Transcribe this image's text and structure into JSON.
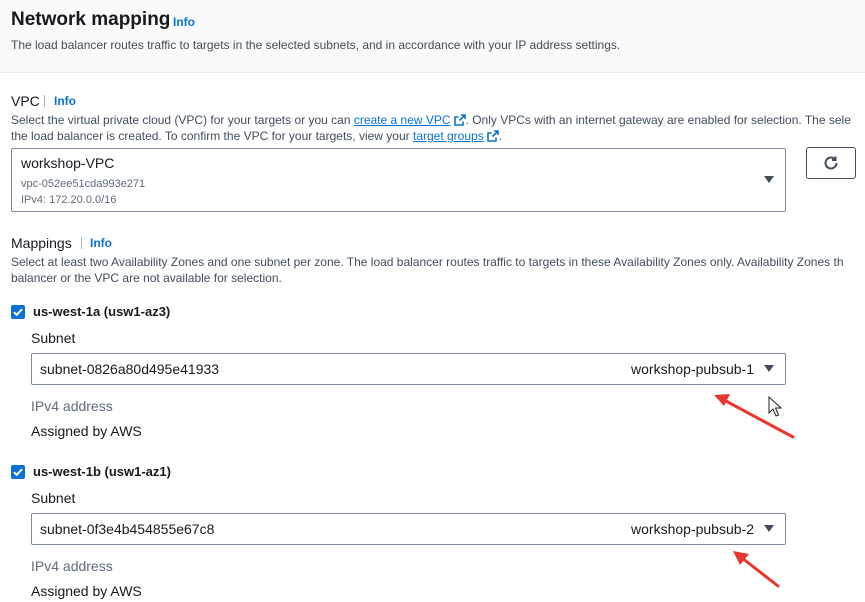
{
  "header": {
    "title": "Network mapping",
    "info": "Info",
    "subtitle": "The load balancer routes traffic to targets in the selected subnets, and in accordance with your IP address settings."
  },
  "vpc": {
    "label": "VPC",
    "info": "Info",
    "desc_line1_pre": "Select the virtual private cloud (VPC) for your targets or you can ",
    "create_link": "create a new VPC",
    "desc_line1_post": ". Only VPCs with an internet gateway are enabled for selection. The sele",
    "desc_line2_pre": "the load balancer is created. To confirm the VPC for your targets, view your ",
    "target_groups_link": "target groups",
    "desc_line2_post": ".",
    "selected": {
      "name": "workshop-VPC",
      "id": "vpc-052ee51cda993e271",
      "cidr": "IPv4: 172.20.0.0/16"
    },
    "refresh_icon": "refresh-icon"
  },
  "mappings": {
    "label": "Mappings",
    "info": "Info",
    "desc_line1": "Select at least two Availability Zones and one subnet per zone. The load balancer routes traffic to targets in these Availability Zones only. Availability Zones th",
    "desc_line2": "balancer or the VPC are not available for selection.",
    "zones": [
      {
        "checked": true,
        "name": "us-west-1a (usw1-az3)",
        "subnet_label": "Subnet",
        "subnet_id": "subnet-0826a80d495e41933",
        "subnet_name": "workshop-pubsub-1",
        "ipv4_label": "IPv4 address",
        "ipv4_value": "Assigned by AWS"
      },
      {
        "checked": true,
        "name": "us-west-1b (usw1-az1)",
        "subnet_label": "Subnet",
        "subnet_id": "subnet-0f3e4b454855e67c8",
        "subnet_name": "workshop-pubsub-2",
        "ipv4_label": "IPv4 address",
        "ipv4_value": "Assigned by AWS"
      }
    ]
  },
  "colors": {
    "link": "#0972d3",
    "checkbox": "#0972d3",
    "annotation_arrow": "#e8372f"
  }
}
